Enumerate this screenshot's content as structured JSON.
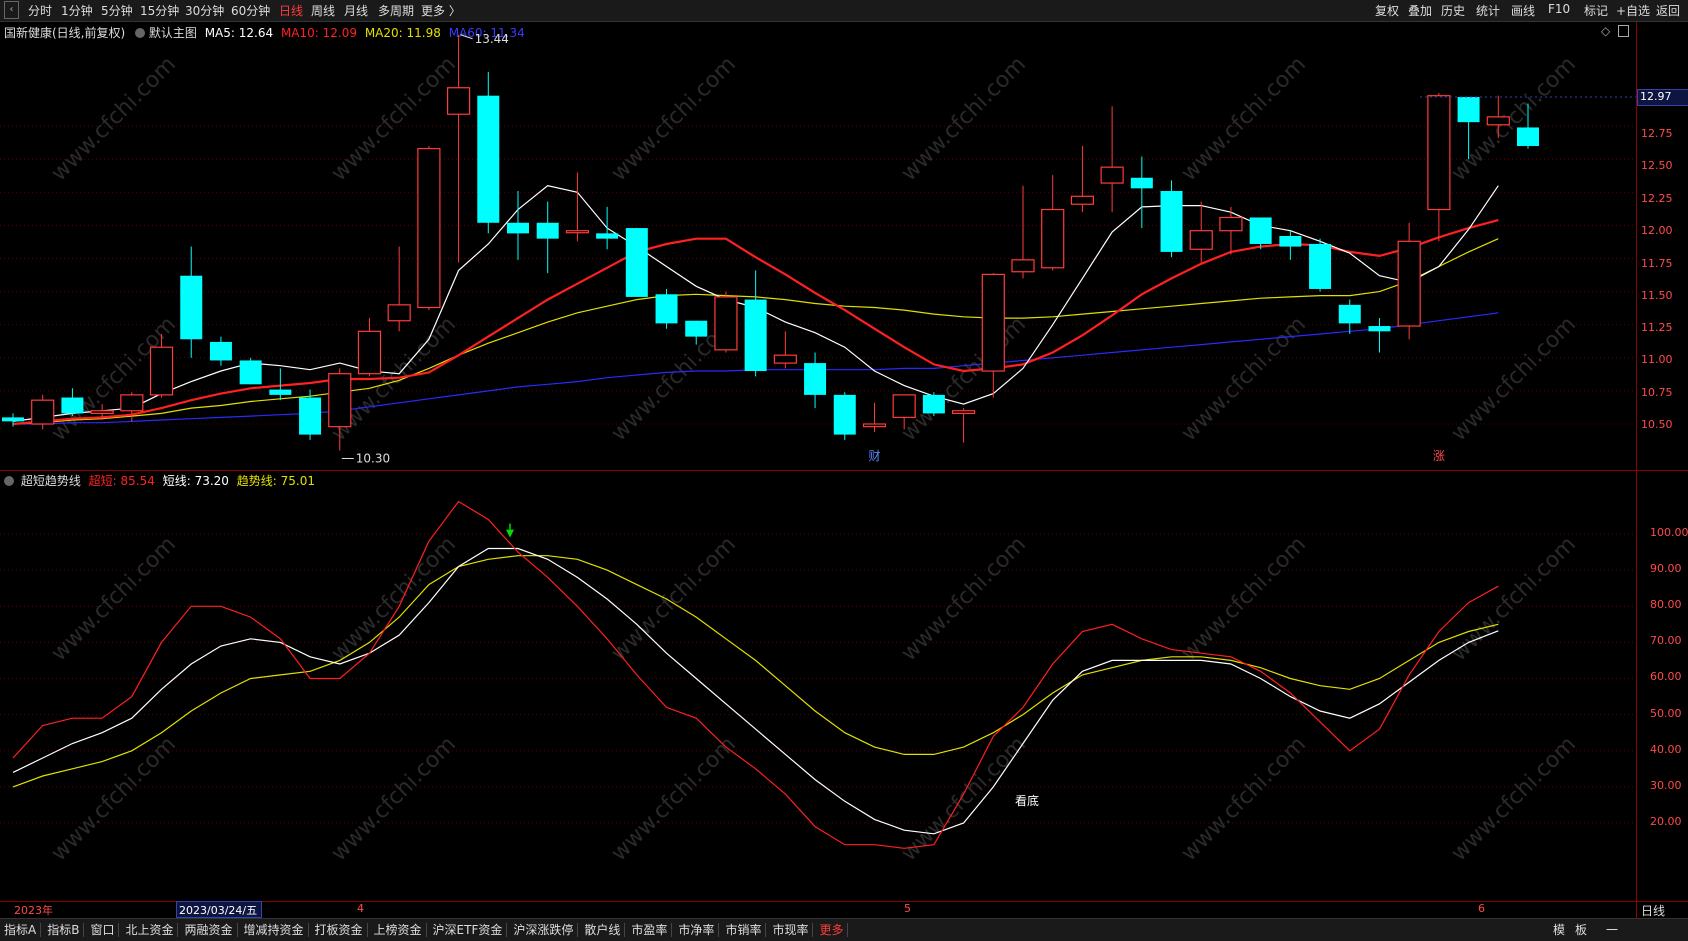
{
  "toolbar": {
    "periods": [
      "分时",
      "1分钟",
      "5分钟",
      "15分钟",
      "30分钟",
      "60分钟",
      "日线",
      "周线",
      "月线",
      "多周期",
      "更多 〉"
    ],
    "active_period": "日线",
    "right_buttons": [
      "复权",
      "叠加",
      "历史",
      "统计",
      "画线",
      "F10",
      "标记",
      "+自选",
      "返回"
    ]
  },
  "main_panel": {
    "stock_name": "国新健康(日线,前复权)",
    "overlay_label": "默认主图",
    "ma5": "MA5: 12.64",
    "ma10": "MA10: 12.09",
    "ma20": "MA20: 11.98",
    "ma60": "MA60: 11.34",
    "high_label": "13.44",
    "low_label": "10.30",
    "current_price": "12.97",
    "axis_ticks": [
      "12.75",
      "12.50",
      "12.25",
      "12.00",
      "11.75",
      "11.50",
      "11.25",
      "11.00",
      "10.75",
      "10.50"
    ],
    "event_marks": [
      "财",
      "涨"
    ]
  },
  "indicator_panel": {
    "name": "超短趋势线",
    "line1": "超短: 85.54",
    "line2": "短线: 73.20",
    "line3": "趋势线: 75.01",
    "annotation": "看底",
    "axis_ticks": [
      "100.00",
      "90.00",
      "80.00",
      "70.00",
      "60.00",
      "50.00",
      "40.00",
      "30.00",
      "20.00"
    ]
  },
  "dates": {
    "year": "2023年",
    "cursor_date": "2023/03/24/五",
    "month_4": "4",
    "month_5": "5",
    "month_6": "6",
    "period_label": "日线"
  },
  "bottom_tabs": [
    "指标A",
    "指标B",
    "窗口",
    "北上资金",
    "两融资金",
    "增减持资金",
    "打板资金",
    "上榜资金",
    "沪深ETF资金",
    "沪深涨跌停",
    "散户线",
    "市盈率",
    "市净率",
    "市销率",
    "市现率",
    "更多"
  ],
  "bottom_right": [
    "模",
    "板",
    "一"
  ],
  "watermark": "www.cfchi.com",
  "colors": {
    "up": "#ff3b3b",
    "down": "#00ffff",
    "ma5": "#ffffff",
    "ma10": "#ff2020",
    "ma20": "#e0e000",
    "ma60": "#2a2aff"
  },
  "chart_data": {
    "type": "candlestick",
    "ylim": [
      10.3,
      13.44
    ],
    "candles": [
      {
        "o": 10.55,
        "h": 10.58,
        "l": 10.48,
        "c": 10.52
      },
      {
        "o": 10.5,
        "h": 10.72,
        "l": 10.46,
        "c": 10.68
      },
      {
        "o": 10.7,
        "h": 10.77,
        "l": 10.56,
        "c": 10.58
      },
      {
        "o": 10.58,
        "h": 10.65,
        "l": 10.53,
        "c": 10.6
      },
      {
        "o": 10.6,
        "h": 10.74,
        "l": 10.52,
        "c": 10.72
      },
      {
        "o": 10.72,
        "h": 11.18,
        "l": 10.7,
        "c": 11.08
      },
      {
        "o": 11.62,
        "h": 11.84,
        "l": 11.0,
        "c": 11.14
      },
      {
        "o": 11.12,
        "h": 11.16,
        "l": 10.94,
        "c": 10.98
      },
      {
        "o": 10.98,
        "h": 11.0,
        "l": 10.8,
        "c": 10.8
      },
      {
        "o": 10.76,
        "h": 10.92,
        "l": 10.68,
        "c": 10.72
      },
      {
        "o": 10.7,
        "h": 10.76,
        "l": 10.38,
        "c": 10.42
      },
      {
        "o": 10.48,
        "h": 10.92,
        "l": 10.3,
        "c": 10.88
      },
      {
        "o": 10.88,
        "h": 11.3,
        "l": 10.86,
        "c": 11.2
      },
      {
        "o": 11.28,
        "h": 11.84,
        "l": 11.2,
        "c": 11.4
      },
      {
        "o": 11.38,
        "h": 12.6,
        "l": 11.36,
        "c": 12.58
      },
      {
        "o": 12.84,
        "h": 13.44,
        "l": 11.72,
        "c": 13.04
      },
      {
        "o": 12.98,
        "h": 13.16,
        "l": 11.94,
        "c": 12.02
      },
      {
        "o": 12.02,
        "h": 12.26,
        "l": 11.74,
        "c": 11.94
      },
      {
        "o": 12.02,
        "h": 12.18,
        "l": 11.64,
        "c": 11.9
      },
      {
        "o": 11.96,
        "h": 12.4,
        "l": 11.88,
        "c": 11.96
      },
      {
        "o": 11.94,
        "h": 12.14,
        "l": 11.82,
        "c": 11.9
      },
      {
        "o": 11.98,
        "h": 11.98,
        "l": 11.5,
        "c": 11.46
      },
      {
        "o": 11.48,
        "h": 11.52,
        "l": 11.22,
        "c": 11.26
      },
      {
        "o": 11.28,
        "h": 11.28,
        "l": 11.1,
        "c": 11.16
      },
      {
        "o": 11.06,
        "h": 11.5,
        "l": 11.04,
        "c": 11.46
      },
      {
        "o": 11.44,
        "h": 11.66,
        "l": 10.86,
        "c": 10.9
      },
      {
        "o": 10.96,
        "h": 11.2,
        "l": 10.92,
        "c": 11.02
      },
      {
        "o": 10.96,
        "h": 11.04,
        "l": 10.62,
        "c": 10.72
      },
      {
        "o": 10.72,
        "h": 10.74,
        "l": 10.38,
        "c": 10.42
      },
      {
        "o": 10.48,
        "h": 10.66,
        "l": 10.44,
        "c": 10.5
      },
      {
        "o": 10.55,
        "h": 10.72,
        "l": 10.46,
        "c": 10.72
      },
      {
        "o": 10.72,
        "h": 10.74,
        "l": 10.56,
        "c": 10.58
      },
      {
        "o": 10.58,
        "h": 10.62,
        "l": 10.36,
        "c": 10.6
      },
      {
        "o": 10.9,
        "h": 11.64,
        "l": 10.7,
        "c": 11.63
      },
      {
        "o": 11.65,
        "h": 12.3,
        "l": 11.6,
        "c": 11.74
      },
      {
        "o": 11.68,
        "h": 12.38,
        "l": 11.66,
        "c": 12.12
      },
      {
        "o": 12.16,
        "h": 12.6,
        "l": 12.1,
        "c": 12.22
      },
      {
        "o": 12.32,
        "h": 12.9,
        "l": 12.1,
        "c": 12.44
      },
      {
        "o": 12.36,
        "h": 12.52,
        "l": 11.98,
        "c": 12.28
      },
      {
        "o": 12.26,
        "h": 12.34,
        "l": 11.76,
        "c": 11.8
      },
      {
        "o": 11.82,
        "h": 12.18,
        "l": 11.72,
        "c": 11.96
      },
      {
        "o": 11.96,
        "h": 12.14,
        "l": 11.78,
        "c": 12.06
      },
      {
        "o": 12.06,
        "h": 12.06,
        "l": 11.82,
        "c": 11.86
      },
      {
        "o": 11.92,
        "h": 11.96,
        "l": 11.74,
        "c": 11.84
      },
      {
        "o": 11.86,
        "h": 11.9,
        "l": 11.5,
        "c": 11.52
      },
      {
        "o": 11.4,
        "h": 11.44,
        "l": 11.18,
        "c": 11.26
      },
      {
        "o": 11.24,
        "h": 11.3,
        "l": 11.04,
        "c": 11.2
      },
      {
        "o": 11.24,
        "h": 12.02,
        "l": 11.14,
        "c": 11.88
      },
      {
        "o": 12.12,
        "h": 13.0,
        "l": 11.88,
        "c": 12.98
      },
      {
        "o": 12.97,
        "h": 12.97,
        "l": 12.5,
        "c": 12.78
      },
      {
        "o": 12.76,
        "h": 12.98,
        "l": 12.66,
        "c": 12.82
      },
      {
        "o": 12.74,
        "h": 12.92,
        "l": 12.58,
        "c": 12.6
      }
    ],
    "ma5": [
      10.52,
      10.55,
      10.58,
      10.6,
      10.62,
      10.73,
      10.82,
      10.9,
      10.96,
      10.94,
      10.91,
      10.96,
      10.9,
      10.88,
      11.14,
      11.66,
      11.86,
      12.12,
      12.3,
      12.25,
      11.98,
      11.84,
      11.69,
      11.54,
      11.44,
      11.38,
      11.27,
      11.19,
      11.08,
      10.9,
      10.79,
      10.71,
      10.65,
      10.73,
      10.92,
      11.25,
      11.6,
      11.95,
      12.14,
      12.15,
      12.15,
      12.1,
      12.0,
      11.96,
      11.88,
      11.79,
      11.62,
      11.57,
      11.69,
      11.97,
      12.3
    ],
    "ma10": [
      10.5,
      10.52,
      10.54,
      10.55,
      10.57,
      10.62,
      10.68,
      10.73,
      10.77,
      10.79,
      10.81,
      10.84,
      10.84,
      10.85,
      10.89,
      11.02,
      11.16,
      11.3,
      11.44,
      11.56,
      11.68,
      11.8,
      11.86,
      11.9,
      11.9,
      11.76,
      11.63,
      11.49,
      11.36,
      11.22,
      11.08,
      10.95,
      10.9,
      10.92,
      10.95,
      11.04,
      11.17,
      11.32,
      11.48,
      11.6,
      11.71,
      11.8,
      11.84,
      11.86,
      11.85,
      11.8,
      11.77,
      11.83,
      11.91,
      11.98,
      12.04
    ],
    "ma20": [
      10.5,
      10.51,
      10.53,
      10.54,
      10.56,
      10.58,
      10.62,
      10.64,
      10.67,
      10.69,
      10.71,
      10.74,
      10.77,
      10.83,
      10.92,
      11.02,
      11.11,
      11.19,
      11.27,
      11.34,
      11.39,
      11.44,
      11.47,
      11.48,
      11.47,
      11.46,
      11.44,
      11.41,
      11.39,
      11.38,
      11.36,
      11.33,
      11.31,
      11.3,
      11.3,
      11.31,
      11.33,
      11.35,
      11.37,
      11.39,
      11.41,
      11.43,
      11.45,
      11.46,
      11.47,
      11.47,
      11.5,
      11.58,
      11.69,
      11.8,
      11.9
    ],
    "ma60": [
      10.5,
      10.5,
      10.51,
      10.51,
      10.52,
      10.53,
      10.54,
      10.55,
      10.56,
      10.57,
      10.58,
      10.6,
      10.63,
      10.66,
      10.69,
      10.72,
      10.75,
      10.78,
      10.8,
      10.82,
      10.85,
      10.87,
      10.89,
      10.9,
      10.9,
      10.91,
      10.91,
      10.91,
      10.91,
      10.91,
      10.92,
      10.92,
      10.94,
      10.96,
      10.98,
      11.0,
      11.02,
      11.04,
      11.06,
      11.08,
      11.1,
      11.12,
      11.14,
      11.16,
      11.18,
      11.2,
      11.22,
      11.25,
      11.28,
      11.31,
      11.34
    ],
    "indicator": {
      "ylim": [
        0,
        110
      ],
      "super_short": [
        38,
        47,
        49,
        49,
        55,
        70,
        80,
        80,
        77,
        71,
        60,
        60,
        67,
        80,
        98,
        109,
        104,
        95,
        88,
        80,
        71,
        61,
        52,
        49,
        41,
        35,
        28,
        19,
        14,
        14,
        13,
        14,
        28,
        44,
        52,
        64,
        73,
        75,
        71,
        68,
        67,
        66,
        62,
        56,
        48,
        40,
        46,
        61,
        73,
        81,
        85.54
      ],
      "short": [
        34,
        38,
        42,
        45,
        49,
        57,
        64,
        69,
        71,
        70,
        66,
        64,
        67,
        72,
        81,
        91,
        96,
        96,
        93,
        88,
        82,
        75,
        67,
        60,
        53,
        46,
        39,
        32,
        26,
        21,
        18,
        17,
        20,
        30,
        42,
        54,
        62,
        65,
        65,
        65,
        65,
        64,
        60,
        55,
        51,
        49,
        53,
        59,
        65,
        70,
        73.2
      ],
      "trend": [
        30,
        33,
        35,
        37,
        40,
        45,
        51,
        56,
        60,
        61,
        62,
        65,
        70,
        77,
        86,
        91,
        93,
        94,
        94,
        93,
        90,
        86,
        82,
        77,
        71,
        65,
        58,
        51,
        45,
        41,
        39,
        39,
        41,
        45,
        50,
        56,
        61,
        63,
        65,
        66,
        66,
        65,
        63,
        60,
        58,
        57,
        60,
        65,
        70,
        73,
        75.01
      ]
    }
  }
}
